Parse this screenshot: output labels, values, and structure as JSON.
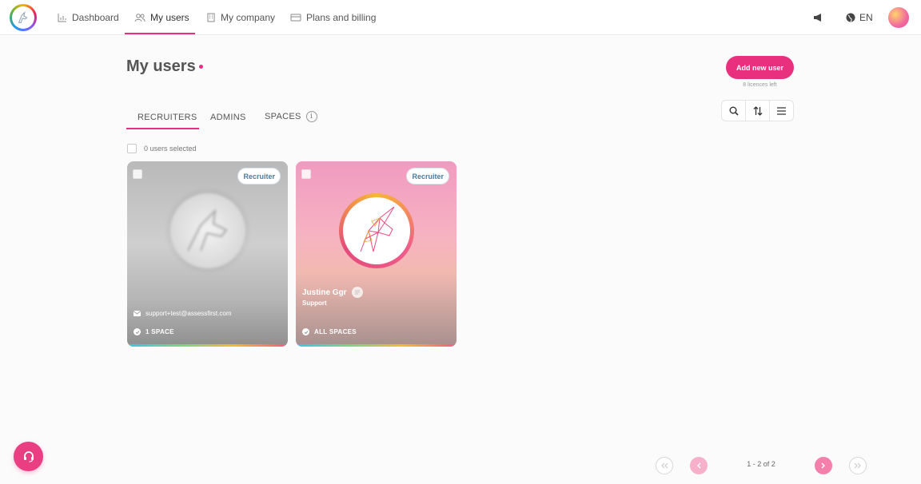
{
  "nav": {
    "items": [
      {
        "label": "Dashboard",
        "icon": "chart-icon"
      },
      {
        "label": "My users",
        "icon": "users-icon"
      },
      {
        "label": "My company",
        "icon": "building-icon"
      },
      {
        "label": "Plans and billing",
        "icon": "billing-icon"
      }
    ],
    "language": "EN"
  },
  "page": {
    "title": "My users",
    "add_button": "Add new user",
    "licences_left": "8 licences left"
  },
  "tabs": [
    "RECRUITERS",
    "ADMINS",
    "SPACES"
  ],
  "selection": {
    "label": "0 users selected"
  },
  "cards": [
    {
      "badge": "Recruiter",
      "name": "",
      "role": "",
      "email": "support+test@assessfirst.com",
      "spaces": "1 SPACE"
    },
    {
      "badge": "Recruiter",
      "name": "Justine Ggr",
      "role": "Support",
      "email": "",
      "spaces": "ALL SPACES"
    }
  ],
  "pagination": {
    "range": "1 - 2 of 2"
  },
  "colors": {
    "accent": "#e9307e",
    "badge_text": "#4a7b9d"
  }
}
